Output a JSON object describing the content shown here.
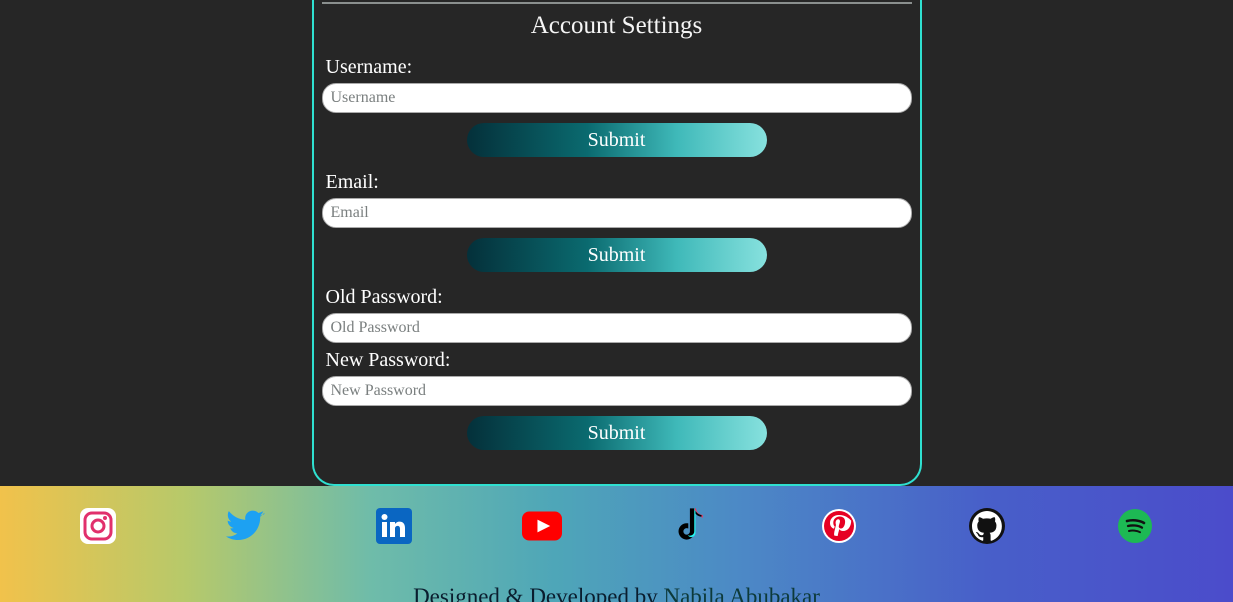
{
  "panel": {
    "title": "Account Settings",
    "username": {
      "label": "Username:",
      "placeholder": "Username",
      "submit": "Submit"
    },
    "email": {
      "label": "Email:",
      "placeholder": "Email",
      "submit": "Submit"
    },
    "old_password": {
      "label": "Old Password:",
      "placeholder": "Old Password"
    },
    "new_password": {
      "label": "New Password:",
      "placeholder": "New Password",
      "submit": "Submit"
    }
  },
  "footer": {
    "social": {
      "instagram": "Instagram",
      "twitter": "Twitter",
      "linkedin": "LinkedIn",
      "youtube": "YouTube",
      "tiktok": "TikTok",
      "pinterest": "Pinterest",
      "github": "GitHub",
      "spotify": "Spotify"
    },
    "credit_prefix": "Designed & Developed by ",
    "author": "Nabila Abubakar"
  }
}
